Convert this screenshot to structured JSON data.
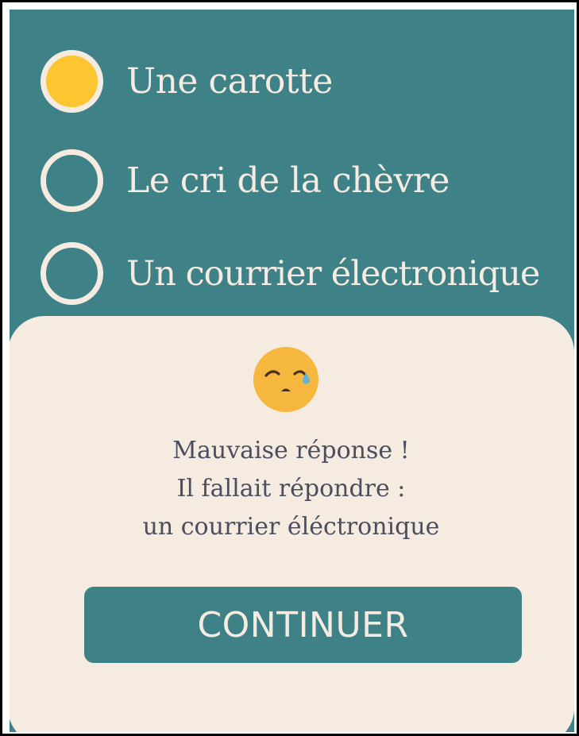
{
  "quiz": {
    "options": [
      {
        "label": "Une carotte",
        "selected": true
      },
      {
        "label": "Le cri de la chèvre",
        "selected": false
      },
      {
        "label": "Un courrier électronique",
        "selected": false
      }
    ]
  },
  "feedback": {
    "emoji_icon": "crying-face-icon",
    "line1": "Mauvaise réponse !",
    "line2": "Il fallait répondre :",
    "line3": "un courrier éléctronique",
    "continue_label": "CONTINUER"
  },
  "colors": {
    "background": "#3e8187",
    "panel": "#f5ebe1",
    "selected": "#fdc631",
    "text_dark": "#4b4e5c",
    "button": "#3e8187"
  }
}
